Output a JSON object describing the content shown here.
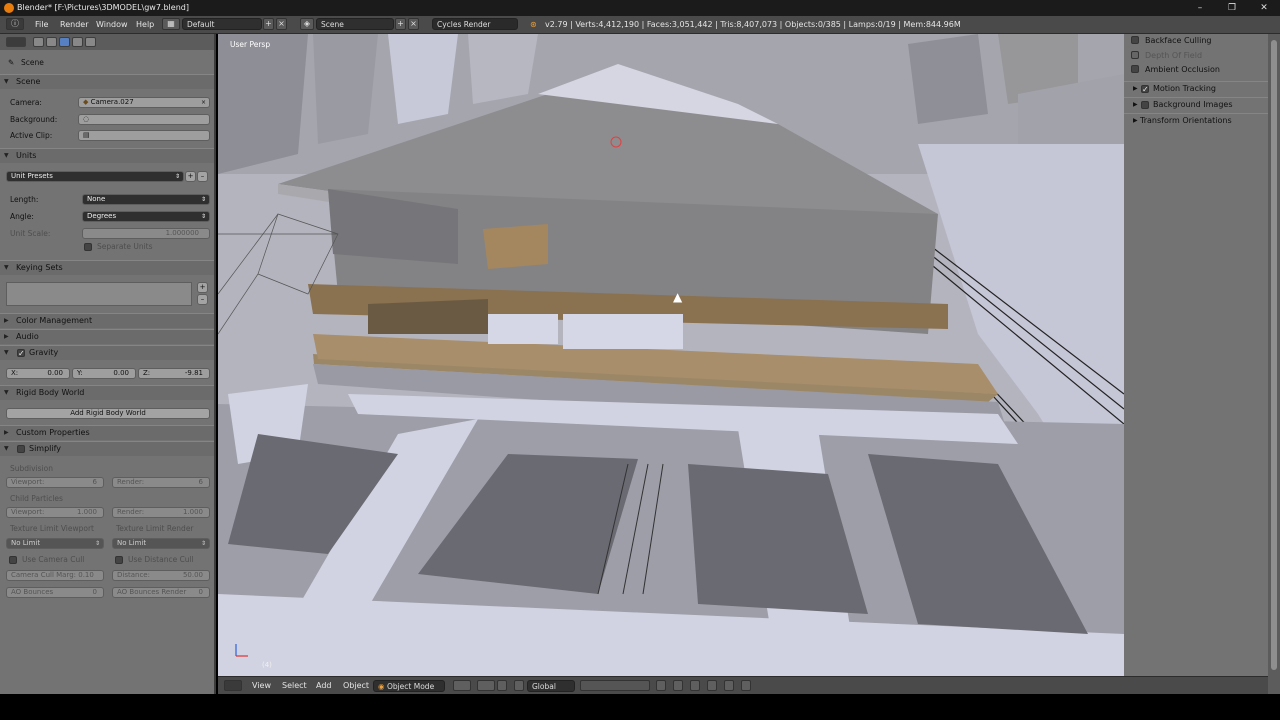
{
  "window": {
    "title": "Blender* [F:\\Pictures\\3DMODEL\\gw7.blend]",
    "controls": [
      "–",
      "❐",
      "✕"
    ]
  },
  "header": {
    "menus": [
      "File",
      "Render",
      "Window",
      "Help"
    ],
    "layout": "Default",
    "scene": "Scene",
    "engine": "Cycles Render",
    "stats": "v2.79 | Verts:4,412,190 | Faces:3,051,442 | Tris:8,407,073 | Objects:0/385 | Lamps:0/19 | Mem:844.96M"
  },
  "properties": {
    "breadcrumb": "Scene",
    "scene_panel": {
      "title": "Scene",
      "camera_label": "Camera:",
      "camera_value": "Camera.027",
      "background_label": "Background:",
      "active_clip_label": "Active Clip:"
    },
    "units_panel": {
      "title": "Units",
      "presets": "Unit Presets",
      "length_label": "Length:",
      "length_value": "None",
      "angle_label": "Angle:",
      "angle_value": "Degrees",
      "unit_scale_label": "Unit Scale:",
      "unit_scale_value": "1.000000",
      "separate_units": "Separate Units"
    },
    "keying_sets": "Keying Sets",
    "color_management": "Color Management",
    "audio": "Audio",
    "gravity": {
      "title": "Gravity",
      "x_label": "X:",
      "x": "0.00",
      "y_label": "Y:",
      "y": "0.00",
      "z_label": "Z:",
      "z": "-9.81"
    },
    "rigid_body": {
      "title": "Rigid Body World",
      "button": "Add Rigid Body World"
    },
    "custom_properties": "Custom Properties",
    "simplify": {
      "title": "Simplify",
      "subdivision": "Subdivision",
      "viewport_label": "Viewport:",
      "viewport_value": "6",
      "render_label": "Render:",
      "render_value": "6",
      "child_particles": "Child Particles",
      "cp_viewport_value": "1.000",
      "cp_render_value": "1.000",
      "tex_limit_viewport": "Texture Limit Viewport",
      "tex_limit_render": "Texture Limit Render",
      "no_limit": "No Limit",
      "use_camera_cull": "Use Camera Cull",
      "use_distance_cull": "Use Distance Cull",
      "camera_cull_margin": "Camera Cull Marg: 0.10",
      "distance": "Distance:",
      "distance_value": "50.00",
      "ao_bounces": "AO Bounces",
      "ao_bounces_value": "0",
      "ao_bounces_render": "AO Bounces Render",
      "ao_bounces_render_value": "0"
    }
  },
  "viewport": {
    "label": "User Persp",
    "frame": "(4)"
  },
  "npanel": {
    "backface_culling": "Backface Culling",
    "depth_of_field": "Depth Of Field",
    "ambient_occlusion": "Ambient Occlusion",
    "motion_tracking": "Motion Tracking",
    "background_images": "Background Images",
    "transform_orientations": "Transform Orientations"
  },
  "bottombar": {
    "view": "View",
    "select": "Select",
    "add": "Add",
    "object": "Object",
    "mode": "Object Mode",
    "orientation": "Global"
  }
}
